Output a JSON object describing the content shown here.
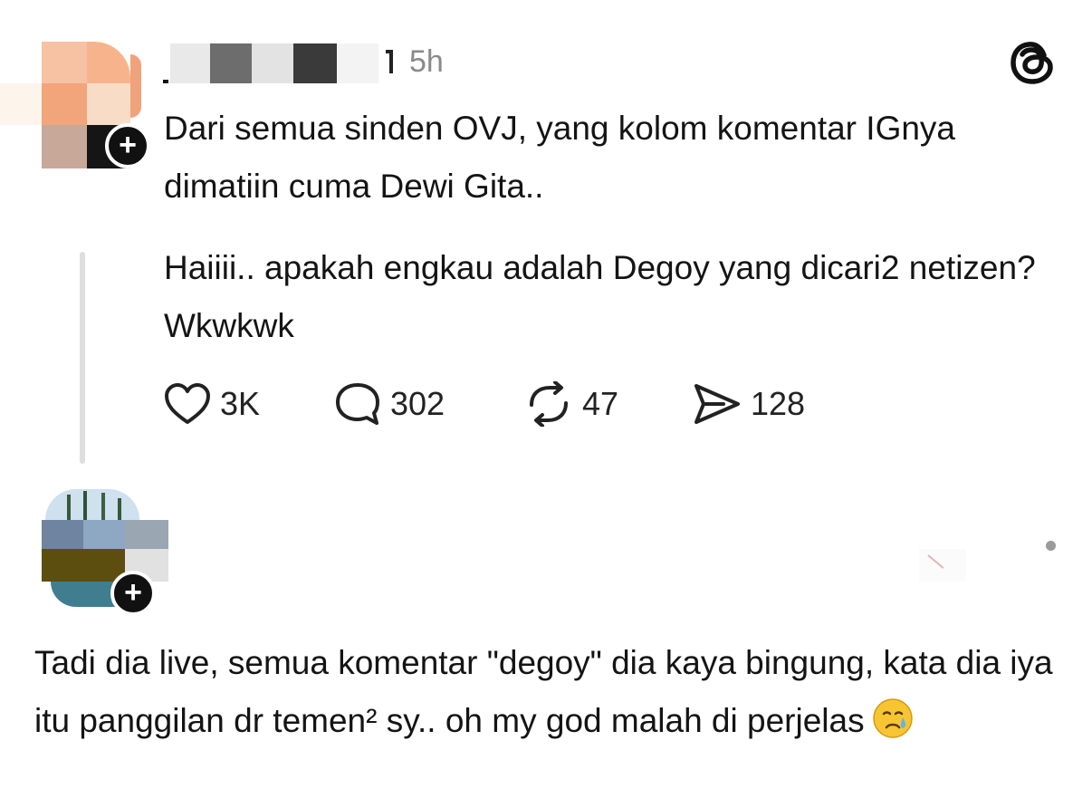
{
  "post": {
    "time": "5h",
    "text": "Dari semua sinden OVJ, yang kolom komentar IGnya dimatiin cuma Dewi Gita..",
    "quote": "Haiiii.. apakah engkau adalah Degoy yang dicari2 netizen? Wkwkwk",
    "actions": {
      "likes": "3K",
      "replies": "302",
      "reposts": "47",
      "shares": "128"
    }
  },
  "reply": {
    "text": "Tadi dia live, semua komentar \"degoy\" dia kaya bingung, kata dia iya itu panggilan dr temen² sy.. oh my god malah di perjelas",
    "emoji": "crying-face"
  },
  "icons": {
    "brand": "threads-logo",
    "like": "heart-icon",
    "reply": "comment-bubble-icon",
    "repost": "repost-icon",
    "share": "send-icon",
    "follow": "plus-icon",
    "more": "more-icon"
  },
  "colors": {
    "text": "#141414",
    "muted": "#8a8a8a",
    "divider": "#dedede",
    "badge": "#111111"
  }
}
